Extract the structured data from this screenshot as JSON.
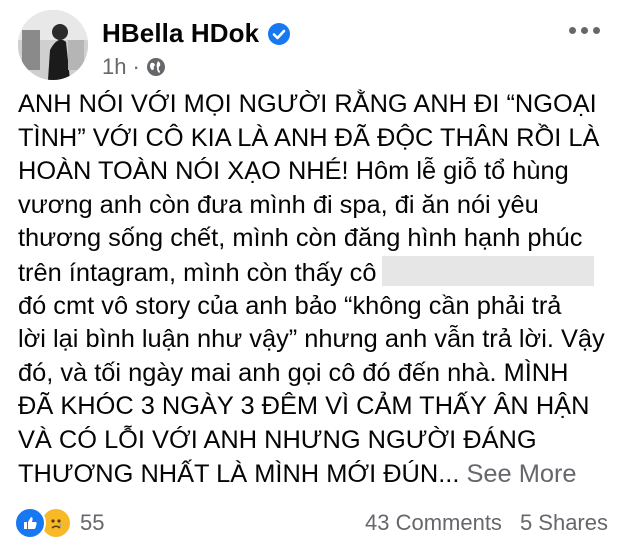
{
  "post": {
    "author": "HBella HDok",
    "verified": true,
    "time": "1h",
    "privacy_icon": "globe-icon",
    "body_lines": [
      "ANH NÓI VỚI MỌI NGƯỜI RẰNG ANH ĐI “NGOẠI",
      "TÌNH” VỚI CÔ KIA LÀ ANH ĐÃ ĐỘC THÂN RỒI LÀ",
      "HOÀN TOÀN NÓI XẠO NHÉ! Hôm lễ giỗ tổ hùng",
      "vương anh còn đưa mình đi spa, đi ăn nói yêu",
      "thương sống chết, mình còn đăng hình hạnh phúc",
      "trên íntagram, mình còn thấy cô",
      "đó cmt vô story của anh bảo “không cần phải trả",
      "lời lại bình luận như vậy” nhưng anh vẫn trả lời. Vậy",
      "đó, và tối ngày mai anh gọi cô đó đến nhà. MÌNH",
      "ĐÃ KHÓC 3 NGÀY 3 ĐÊM VÌ CẢM THẤY ÂN HẬN",
      "VÀ CÓ LỖI VỚI ANH NHƯNG NGƯỜI ĐÁNG",
      "THƯƠNG NHẤT LÀ MÌNH MỚI ĐÚN..."
    ],
    "see_more": "See More"
  },
  "footer": {
    "reaction_count": "55",
    "comments": "43 Comments",
    "shares": "5 Shares"
  },
  "colors": {
    "verified": "#1877f2",
    "like": "#1877f2",
    "sad": "#f7b928",
    "secondary_text": "#65676b"
  }
}
